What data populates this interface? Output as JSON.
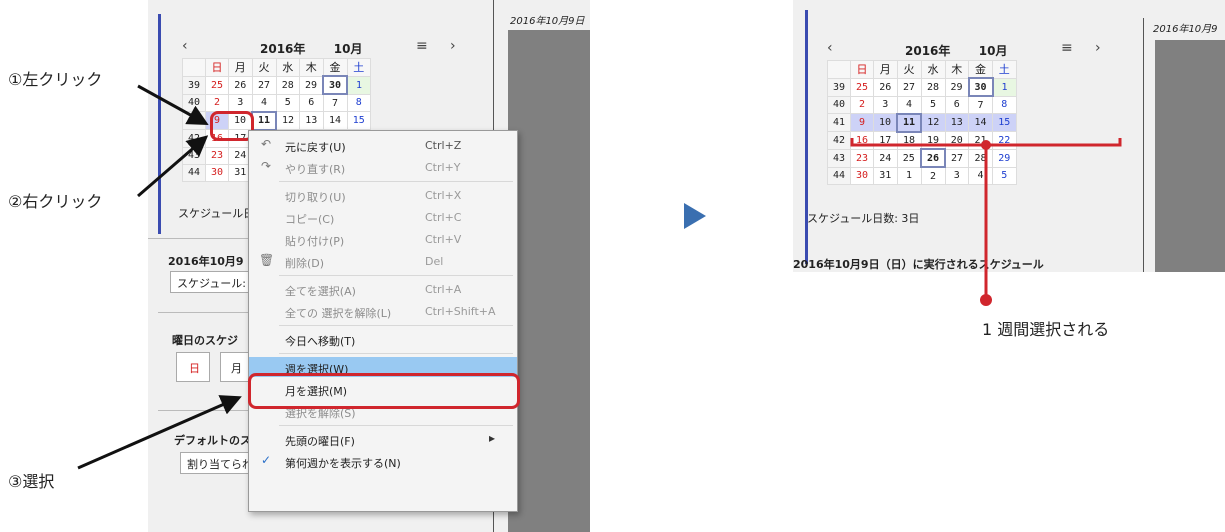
{
  "annotations": {
    "left_click": "①左クリック",
    "right_click": "②右クリック",
    "select": "③選択",
    "week_selected": "1 週間選択される"
  },
  "calendar": {
    "prev_label": "‹",
    "next_label": "›",
    "title": "2016年　10月",
    "title_left": "2016年",
    "title_right": "10月",
    "dropdown_mark": "˯",
    "menu_icon": "≡",
    "day_headers": [
      "日",
      "月",
      "火",
      "水",
      "木",
      "金",
      "土"
    ],
    "rows": [
      {
        "week": "39",
        "days": [
          "25",
          "26",
          "27",
          "28",
          "29",
          "30",
          "1"
        ]
      },
      {
        "week": "40",
        "days": [
          "2",
          "3",
          "4",
          "5",
          "6",
          "7",
          "8"
        ]
      },
      {
        "week": "41",
        "days": [
          "9",
          "10",
          "11",
          "12",
          "13",
          "14",
          "15"
        ]
      },
      {
        "week": "42",
        "days": [
          "16",
          "17",
          "18",
          "19",
          "20",
          "21",
          "22"
        ]
      },
      {
        "week": "43",
        "days": [
          "23",
          "24",
          "25",
          "26",
          "27",
          "28",
          "29"
        ]
      },
      {
        "week": "44",
        "days": [
          "30",
          "31",
          "1",
          "2",
          "3",
          "4",
          "5"
        ]
      }
    ],
    "schedule_count_left": "スケジュール日",
    "schedule_count_right": "スケジュール日数: 3日"
  },
  "left_panel": {
    "preview_date": "2016年10月9日",
    "date_heading": "2016年10月9",
    "schedule_label": "スケジュール:",
    "weekday_heading": "曜日のスケジ",
    "weekday_sun": "日",
    "weekday_mon": "月",
    "default_heading": "デフォルトのス",
    "assign_label": "割り当てられ"
  },
  "right_panel": {
    "preview_date": "2016年10月9",
    "date_heading": "2016年10月9日（日）に実行されるスケジュール"
  },
  "context_menu": {
    "items": [
      {
        "label": "元に戻す(U)",
        "shortcut": "Ctrl+Z",
        "icon": "undo-icon",
        "glyph": "↶",
        "disabled": false
      },
      {
        "label": "やり直す(R)",
        "shortcut": "Ctrl+Y",
        "icon": "redo-icon",
        "glyph": "↷",
        "disabled": true
      },
      {
        "label": "切り取り(U)",
        "shortcut": "Ctrl+X",
        "icon": "",
        "glyph": "",
        "disabled": true
      },
      {
        "label": "コピー(C)",
        "shortcut": "Ctrl+C",
        "icon": "",
        "glyph": "",
        "disabled": true
      },
      {
        "label": "貼り付け(P)",
        "shortcut": "Ctrl+V",
        "icon": "",
        "glyph": "",
        "disabled": true
      },
      {
        "label": "削除(D)",
        "shortcut": "Del",
        "icon": "trash-icon",
        "glyph": "🗑",
        "disabled": true
      },
      {
        "label": "全てを選択(A)",
        "shortcut": "Ctrl+A",
        "icon": "",
        "glyph": "",
        "disabled": true
      },
      {
        "label": "全ての 選択を解除(L)",
        "shortcut": "Ctrl+Shift+A",
        "icon": "",
        "glyph": "",
        "disabled": true
      },
      {
        "label": "今日へ移動(T)",
        "shortcut": "",
        "icon": "",
        "glyph": "",
        "disabled": false
      },
      {
        "label": "週を選択(W)",
        "shortcut": "",
        "icon": "",
        "glyph": "",
        "disabled": false
      },
      {
        "label": "月を選択(M)",
        "shortcut": "",
        "icon": "",
        "glyph": "",
        "disabled": false
      },
      {
        "label": "選択を解除(S)",
        "shortcut": "",
        "icon": "",
        "glyph": "",
        "disabled": true
      },
      {
        "label": "先頭の曜日(F)",
        "shortcut": "",
        "icon": "submenu-arrow-icon",
        "glyph": "▸",
        "disabled": false
      },
      {
        "label": "第何週かを表示する(N)",
        "shortcut": "",
        "icon": "check-icon",
        "glyph": "✓",
        "disabled": false
      }
    ]
  },
  "colors": {
    "accent_red": "#d0262d",
    "highlight_blue": "#99c9f2",
    "selected_week": "#cdd2f7",
    "arrow_triangle": "#3a6fb0"
  }
}
